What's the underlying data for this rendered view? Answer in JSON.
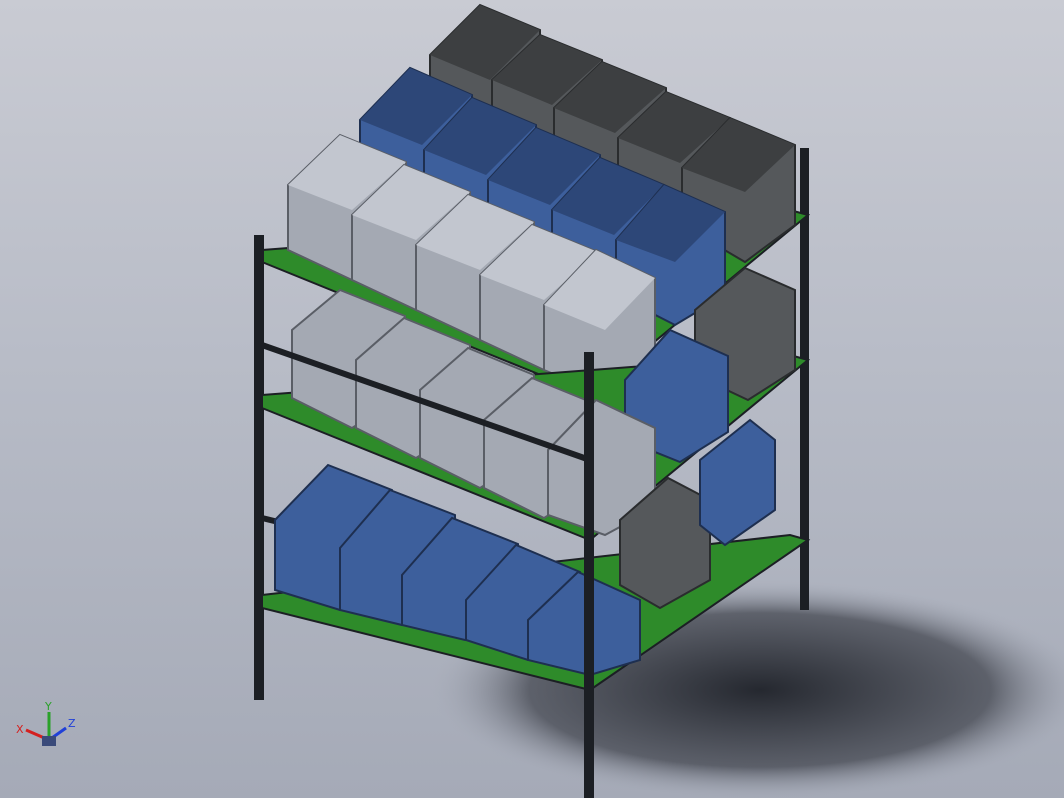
{
  "viewport": {
    "background_top": "#c9cbd3",
    "background_bottom": "#a5aab7"
  },
  "colors": {
    "frame_post": "#1c1f24",
    "shelf_green": "#2e8b2a",
    "crate_dark_gray": "#4f5254",
    "crate_blue": "#3d5f9c",
    "crate_light_gray": "#9ea3ad",
    "shadow": "#1e2128"
  },
  "rack": {
    "levels": [
      {
        "name": "top",
        "crates": [
          "dark-gray",
          "dark-gray",
          "dark-gray",
          "dark-gray",
          "dark-gray",
          "blue",
          "blue",
          "blue",
          "blue",
          "blue",
          "light-gray",
          "light-gray",
          "light-gray",
          "light-gray",
          "light-gray"
        ]
      },
      {
        "name": "middle",
        "crates": [
          "dark-gray",
          "blue",
          "light-gray",
          "light-gray",
          "light-gray",
          "light-gray",
          "light-gray"
        ]
      },
      {
        "name": "bottom",
        "crates": [
          "dark-gray",
          "blue",
          "blue",
          "blue",
          "blue",
          "blue",
          "blue"
        ]
      }
    ]
  },
  "triad": {
    "x_label": "X",
    "y_label": "Y",
    "z_label": "Z",
    "x_color": "#d42020",
    "y_color": "#2aa12a",
    "z_color": "#2040d8"
  }
}
